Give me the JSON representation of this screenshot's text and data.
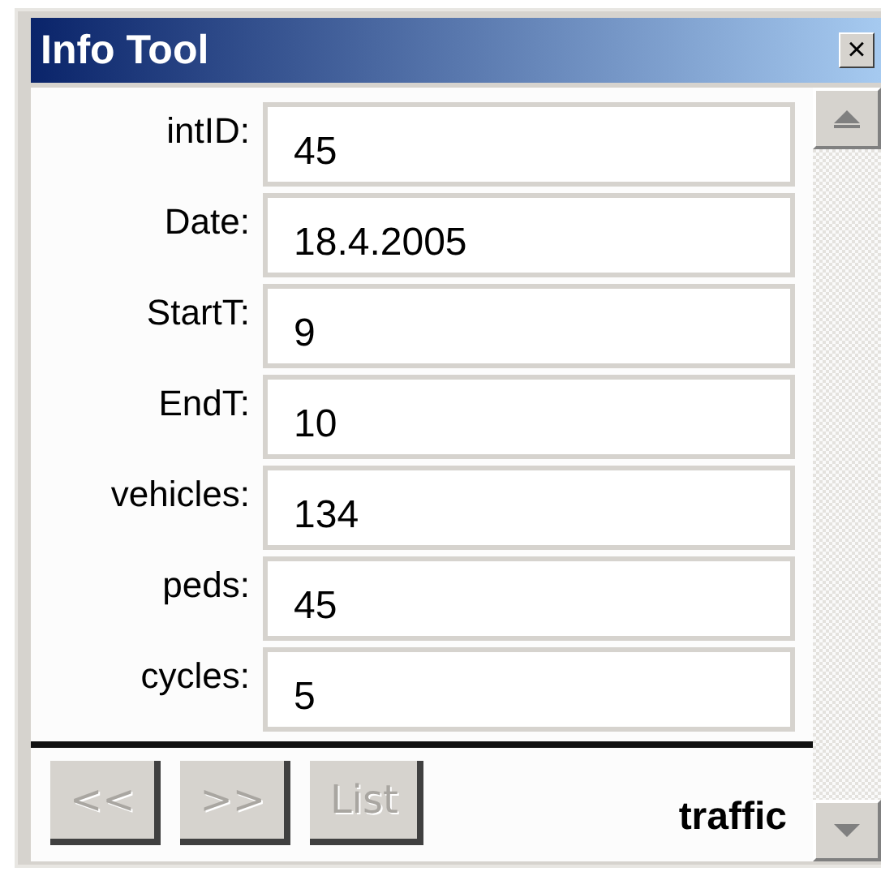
{
  "window": {
    "title": "Info Tool",
    "close": "×"
  },
  "fields": [
    {
      "label": "intID:",
      "value": "45"
    },
    {
      "label": "Date:",
      "value": "18.4.2005"
    },
    {
      "label": "StartT:",
      "value": "9"
    },
    {
      "label": "EndT:",
      "value": "10"
    },
    {
      "label": "vehicles:",
      "value": "134"
    },
    {
      "label": "peds:",
      "value": "45"
    },
    {
      "label": "cycles:",
      "value": "5"
    }
  ],
  "buttons": [
    {
      "label": "<<",
      "disabled": true
    },
    {
      "label": ">>",
      "disabled": true
    },
    {
      "label": "List",
      "disabled": true
    }
  ],
  "layer": "traffic"
}
